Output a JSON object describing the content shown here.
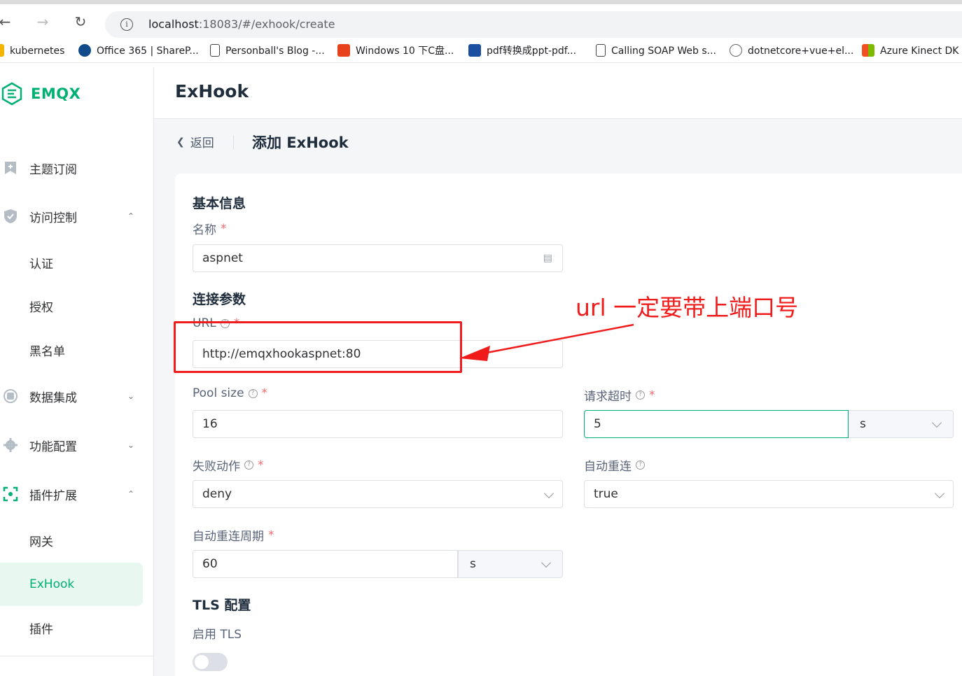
{
  "browser": {
    "url_host": "localhost",
    "url_rest": ":18083/#/exhook/create",
    "bookmarks": [
      {
        "label": "kubernetes",
        "color": "#f4b400"
      },
      {
        "label": "Office 365 | ShareP...",
        "color": "#0f4a8a"
      },
      {
        "label": "Personball's Blog -...",
        "color": "#ffffff"
      },
      {
        "label": "Windows 10 下C盘...",
        "color": "#e8421c"
      },
      {
        "label": "pdf转换成ppt-pdf...",
        "color": "#1a4fa0"
      },
      {
        "label": "Calling SOAP Web s...",
        "color": "#ffffff"
      },
      {
        "label": "dotnetcore+vue+el...",
        "color": "#ffffff"
      },
      {
        "label": "Azure Kinect DK 文",
        "color": "#00a4ef"
      }
    ]
  },
  "sidebar": {
    "logo": "EMQX",
    "items": [
      {
        "label": "主题订阅",
        "icon": "subscribe-icon"
      },
      {
        "label": "访问控制",
        "icon": "shield-icon",
        "chevron": "⌃"
      },
      {
        "label": "认证"
      },
      {
        "label": "授权"
      },
      {
        "label": "黑名单"
      },
      {
        "label": "数据集成",
        "icon": "integration-icon",
        "chevron": "⌄"
      },
      {
        "label": "功能配置",
        "icon": "gear-icon",
        "chevron": "⌄"
      },
      {
        "label": "插件扩展",
        "icon": "plugin-icon",
        "chevron": "⌃"
      },
      {
        "label": "网关"
      },
      {
        "label": "ExHook"
      },
      {
        "label": "插件"
      }
    ]
  },
  "header": {
    "title": "ExHook"
  },
  "page": {
    "back": "返回",
    "title": "添加 ExHook"
  },
  "form": {
    "basic_section": "基本信息",
    "name_label": "名称",
    "name_value": "aspnet",
    "conn_section": "连接参数",
    "url_label": "URL",
    "url_value": "http://emqxhookaspnet:80",
    "pool_label": "Pool size",
    "pool_value": "16",
    "timeout_label": "请求超时",
    "timeout_value": "5",
    "timeout_unit": "s",
    "fail_label": "失败动作",
    "fail_value": "deny",
    "reconnect_label": "自动重连",
    "reconnect_value": "true",
    "reconnect_period_label": "自动重连周期",
    "reconnect_period_value": "60",
    "reconnect_period_unit": "s",
    "tls_section": "TLS 配置",
    "tls_label": "启用 TLS",
    "required_mark": "*"
  },
  "annotation": {
    "text": "url 一定要带上端口号",
    "color": "#f01c1c"
  }
}
